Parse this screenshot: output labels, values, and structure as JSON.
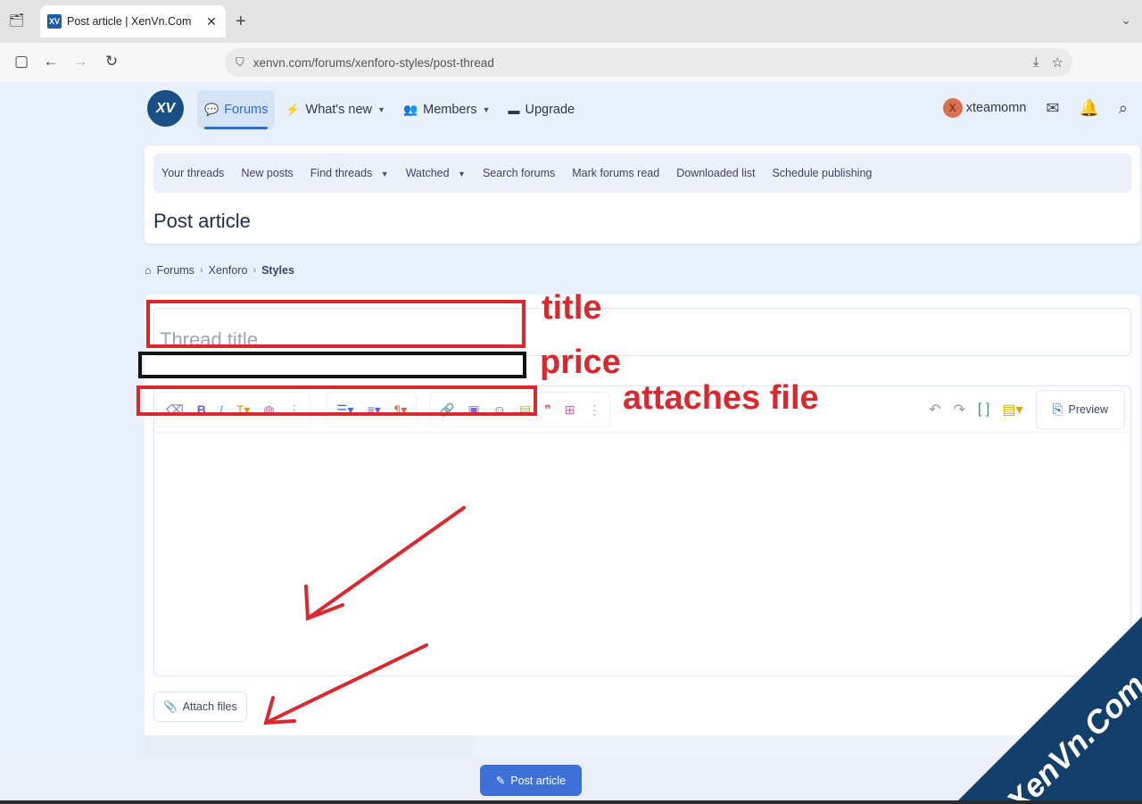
{
  "browser": {
    "tab_title": "Post article | XenVn.Com",
    "url": "xenvn.com/forums/xenforo-styles/post-thread"
  },
  "header": {
    "logo_text": "XV",
    "nav": [
      {
        "label": "Forums",
        "active": true
      },
      {
        "label": "What's new"
      },
      {
        "label": "Members"
      },
      {
        "label": "Upgrade"
      }
    ],
    "avatar_letter": "X",
    "username": "xteamomn"
  },
  "subnav": {
    "items": [
      "Your threads",
      "New posts",
      "Find threads",
      "Watched",
      "Search forums",
      "Mark forums read",
      "Downloaded list",
      "Schedule publishing"
    ]
  },
  "page_title": "Post article",
  "breadcrumb": [
    "Forums",
    "Xenforo",
    "Styles"
  ],
  "form": {
    "title_placeholder": "Thread title",
    "preview_label": "Preview",
    "attach_label": "Attach files",
    "submit_label": "Post article"
  },
  "annotations": {
    "title": "title",
    "price": "price",
    "attach": "attaches file"
  },
  "watermark": "XenVn.Com",
  "colors": {
    "accent": "#2b6cd8",
    "annotation": "#d9282f",
    "submit": "#3e71d8"
  }
}
